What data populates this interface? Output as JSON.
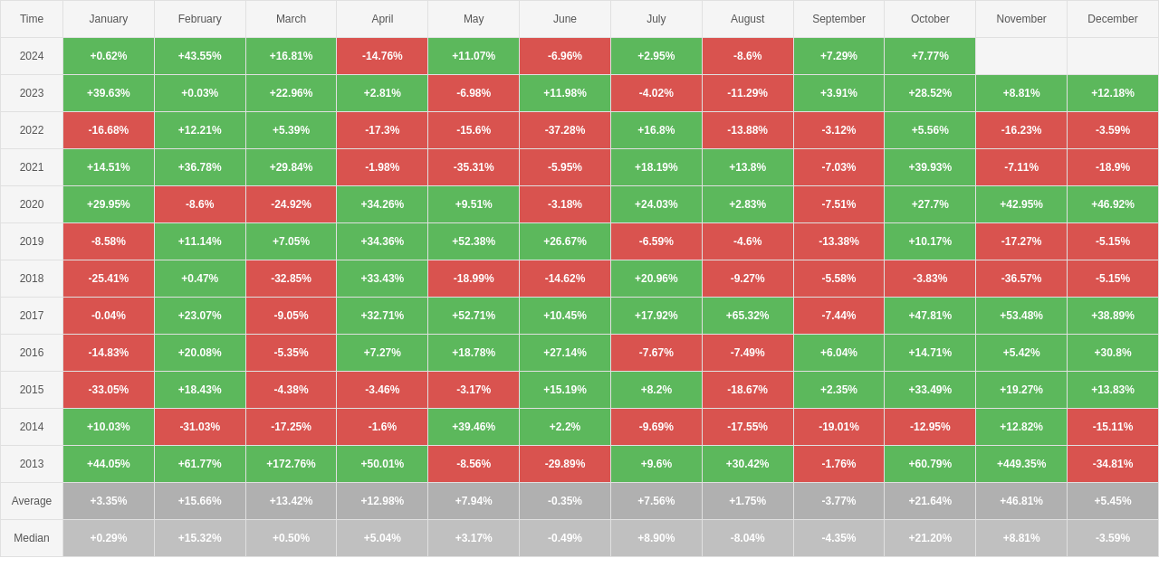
{
  "headers": [
    "Time",
    "January",
    "February",
    "March",
    "April",
    "May",
    "June",
    "July",
    "August",
    "September",
    "October",
    "November",
    "December"
  ],
  "rows": [
    {
      "year": "2024",
      "cells": [
        "+0.62%",
        "+43.55%",
        "+16.81%",
        "-14.76%",
        "+11.07%",
        "-6.96%",
        "+2.95%",
        "-8.6%",
        "+7.29%",
        "+7.77%",
        "",
        ""
      ]
    },
    {
      "year": "2023",
      "cells": [
        "+39.63%",
        "+0.03%",
        "+22.96%",
        "+2.81%",
        "-6.98%",
        "+11.98%",
        "-4.02%",
        "-11.29%",
        "+3.91%",
        "+28.52%",
        "+8.81%",
        "+12.18%"
      ]
    },
    {
      "year": "2022",
      "cells": [
        "-16.68%",
        "+12.21%",
        "+5.39%",
        "-17.3%",
        "-15.6%",
        "-37.28%",
        "+16.8%",
        "-13.88%",
        "-3.12%",
        "+5.56%",
        "-16.23%",
        "-3.59%"
      ]
    },
    {
      "year": "2021",
      "cells": [
        "+14.51%",
        "+36.78%",
        "+29.84%",
        "-1.98%",
        "-35.31%",
        "-5.95%",
        "+18.19%",
        "+13.8%",
        "-7.03%",
        "+39.93%",
        "-7.11%",
        "-18.9%"
      ]
    },
    {
      "year": "2020",
      "cells": [
        "+29.95%",
        "-8.6%",
        "-24.92%",
        "+34.26%",
        "+9.51%",
        "-3.18%",
        "+24.03%",
        "+2.83%",
        "-7.51%",
        "+27.7%",
        "+42.95%",
        "+46.92%"
      ]
    },
    {
      "year": "2019",
      "cells": [
        "-8.58%",
        "+11.14%",
        "+7.05%",
        "+34.36%",
        "+52.38%",
        "+26.67%",
        "-6.59%",
        "-4.6%",
        "-13.38%",
        "+10.17%",
        "-17.27%",
        "-5.15%"
      ]
    },
    {
      "year": "2018",
      "cells": [
        "-25.41%",
        "+0.47%",
        "-32.85%",
        "+33.43%",
        "-18.99%",
        "-14.62%",
        "+20.96%",
        "-9.27%",
        "-5.58%",
        "-3.83%",
        "-36.57%",
        "-5.15%"
      ]
    },
    {
      "year": "2017",
      "cells": [
        "-0.04%",
        "+23.07%",
        "-9.05%",
        "+32.71%",
        "+52.71%",
        "+10.45%",
        "+17.92%",
        "+65.32%",
        "-7.44%",
        "+47.81%",
        "+53.48%",
        "+38.89%"
      ]
    },
    {
      "year": "2016",
      "cells": [
        "-14.83%",
        "+20.08%",
        "-5.35%",
        "+7.27%",
        "+18.78%",
        "+27.14%",
        "-7.67%",
        "-7.49%",
        "+6.04%",
        "+14.71%",
        "+5.42%",
        "+30.8%"
      ]
    },
    {
      "year": "2015",
      "cells": [
        "-33.05%",
        "+18.43%",
        "-4.38%",
        "-3.46%",
        "-3.17%",
        "+15.19%",
        "+8.2%",
        "-18.67%",
        "+2.35%",
        "+33.49%",
        "+19.27%",
        "+13.83%"
      ]
    },
    {
      "year": "2014",
      "cells": [
        "+10.03%",
        "-31.03%",
        "-17.25%",
        "-1.6%",
        "+39.46%",
        "+2.2%",
        "-9.69%",
        "-17.55%",
        "-19.01%",
        "-12.95%",
        "+12.82%",
        "-15.11%"
      ]
    },
    {
      "year": "2013",
      "cells": [
        "+44.05%",
        "+61.77%",
        "+172.76%",
        "+50.01%",
        "-8.56%",
        "-29.89%",
        "+9.6%",
        "+30.42%",
        "-1.76%",
        "+60.79%",
        "+449.35%",
        "-34.81%"
      ]
    }
  ],
  "average": {
    "label": "Average",
    "cells": [
      "+3.35%",
      "+15.66%",
      "+13.42%",
      "+12.98%",
      "+7.94%",
      "-0.35%",
      "+7.56%",
      "+1.75%",
      "-3.77%",
      "+21.64%",
      "+46.81%",
      "+5.45%"
    ]
  },
  "median": {
    "label": "Median",
    "cells": [
      "+0.29%",
      "+15.32%",
      "+0.50%",
      "+5.04%",
      "+3.17%",
      "-0.49%",
      "+8.90%",
      "-8.04%",
      "-4.35%",
      "+21.20%",
      "+8.81%",
      "-3.59%"
    ]
  }
}
